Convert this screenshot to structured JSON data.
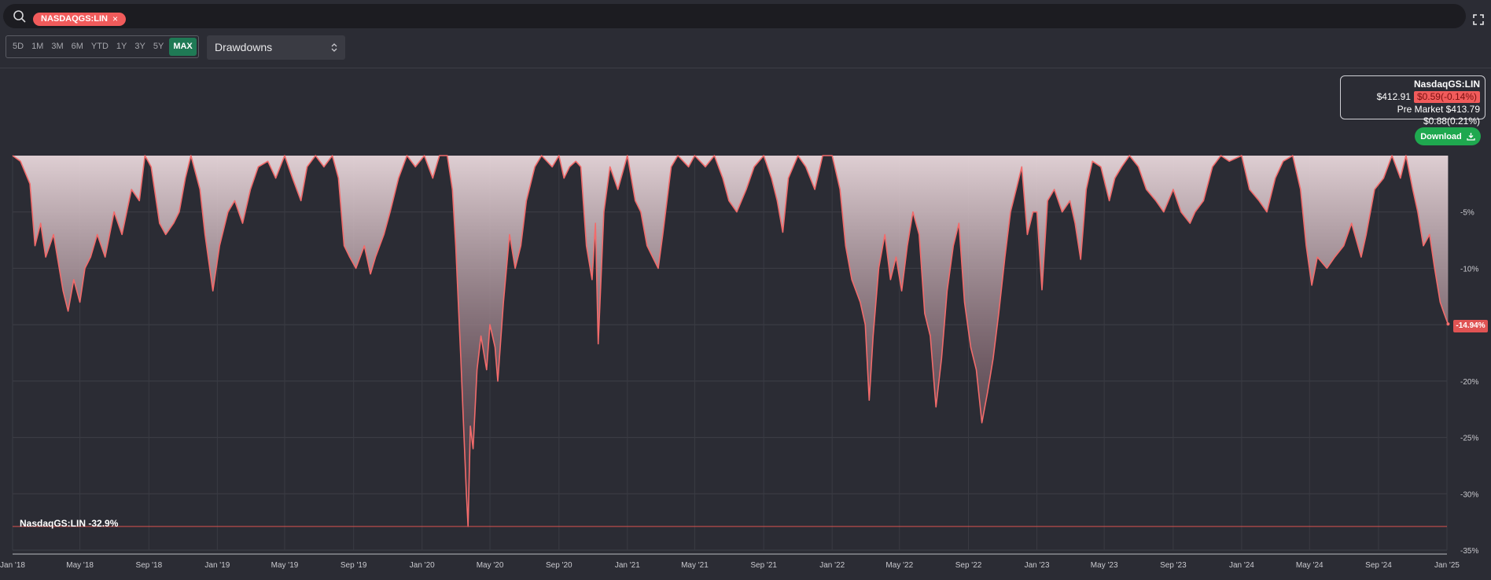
{
  "search": {
    "ticker": "NASDAQGS:LIN",
    "close_glyph": "×"
  },
  "toolbar": {
    "ranges": [
      "5D",
      "1M",
      "3M",
      "6M",
      "YTD",
      "1Y",
      "3Y",
      "5Y",
      "MAX"
    ],
    "active_range": "MAX",
    "metric_select": "Drawdowns"
  },
  "quote": {
    "symbol": "NasdaqGS:LIN",
    "price": "$412.91",
    "change": "$0.59(-0.14%)",
    "premarket": "Pre Market $413.79 $0.88(0.21%)"
  },
  "download_label": "Download",
  "colors": {
    "line": "#f26b6b",
    "up": "#1fa84f",
    "accent": "#f15b5b",
    "background": "#2b2c34"
  },
  "chart_data": {
    "type": "area",
    "series": [
      {
        "name": "NasdaqGS:LIN"
      }
    ],
    "x_ticks": [
      "Jan '18",
      "May '18",
      "Sep '18",
      "Jan '19",
      "May '19",
      "Sep '19",
      "Jan '20",
      "May '20",
      "Sep '20",
      "Jan '21",
      "May '21",
      "Sep '21",
      "Jan '22",
      "May '22",
      "Sep '22",
      "Jan '23",
      "May '23",
      "Sep '23",
      "Jan '24",
      "May '24",
      "Sep '24",
      "Jan '25"
    ],
    "y_ticks": [
      "-5%",
      "-10%",
      "-15%",
      "-20%",
      "-25%",
      "-30%",
      "-35%"
    ],
    "ylim": [
      -35,
      0
    ],
    "xlim": [
      "2018-01-01",
      "2025-01-01"
    ],
    "last_value_label": "-14.94%",
    "min_label": "NasdaqGS:LIN -32.9%",
    "min_value": -32.9,
    "points": [
      [
        "2018-01-01",
        0
      ],
      [
        "2018-01-15",
        -0.5
      ],
      [
        "2018-02-01",
        -2.5
      ],
      [
        "2018-02-10",
        -8
      ],
      [
        "2018-02-20",
        -6
      ],
      [
        "2018-03-01",
        -9
      ],
      [
        "2018-03-15",
        -7
      ],
      [
        "2018-04-01",
        -12
      ],
      [
        "2018-04-10",
        -13.8
      ],
      [
        "2018-04-20",
        -11
      ],
      [
        "2018-05-01",
        -13
      ],
      [
        "2018-05-10",
        -10
      ],
      [
        "2018-05-20",
        -9
      ],
      [
        "2018-06-01",
        -7
      ],
      [
        "2018-06-15",
        -9
      ],
      [
        "2018-07-01",
        -5
      ],
      [
        "2018-07-15",
        -7
      ],
      [
        "2018-08-01",
        -3
      ],
      [
        "2018-08-15",
        -4
      ],
      [
        "2018-08-25",
        0
      ],
      [
        "2018-09-05",
        -1
      ],
      [
        "2018-09-20",
        -6
      ],
      [
        "2018-10-01",
        -7
      ],
      [
        "2018-10-15",
        -6
      ],
      [
        "2018-10-25",
        -5
      ],
      [
        "2018-11-05",
        -2
      ],
      [
        "2018-11-15",
        0
      ],
      [
        "2018-12-01",
        -3
      ],
      [
        "2018-12-10",
        -7
      ],
      [
        "2018-12-24",
        -12
      ],
      [
        "2019-01-05",
        -8
      ],
      [
        "2019-01-20",
        -5
      ],
      [
        "2019-02-01",
        -4
      ],
      [
        "2019-02-15",
        -6
      ],
      [
        "2019-03-01",
        -3
      ],
      [
        "2019-03-15",
        -1
      ],
      [
        "2019-04-01",
        -0.5
      ],
      [
        "2019-04-15",
        -2
      ],
      [
        "2019-05-01",
        0
      ],
      [
        "2019-05-15",
        -2
      ],
      [
        "2019-05-30",
        -4
      ],
      [
        "2019-06-10",
        -1
      ],
      [
        "2019-06-25",
        0
      ],
      [
        "2019-07-10",
        -1
      ],
      [
        "2019-07-25",
        0
      ],
      [
        "2019-08-05",
        -2
      ],
      [
        "2019-08-15",
        -8
      ],
      [
        "2019-08-25",
        -9
      ],
      [
        "2019-09-05",
        -10
      ],
      [
        "2019-09-20",
        -8
      ],
      [
        "2019-10-01",
        -10.5
      ],
      [
        "2019-10-10",
        -9
      ],
      [
        "2019-10-25",
        -7
      ],
      [
        "2019-11-05",
        -5
      ],
      [
        "2019-11-20",
        -2
      ],
      [
        "2019-12-05",
        0
      ],
      [
        "2019-12-20",
        -1
      ],
      [
        "2020-01-05",
        0
      ],
      [
        "2020-01-20",
        -2
      ],
      [
        "2020-02-01",
        0
      ],
      [
        "2020-02-15",
        0
      ],
      [
        "2020-02-24",
        -3
      ],
      [
        "2020-03-01",
        -8
      ],
      [
        "2020-03-10",
        -18
      ],
      [
        "2020-03-15",
        -24
      ],
      [
        "2020-03-20",
        -30
      ],
      [
        "2020-03-23",
        -32.9
      ],
      [
        "2020-03-27",
        -24
      ],
      [
        "2020-04-01",
        -26
      ],
      [
        "2020-04-08",
        -19
      ],
      [
        "2020-04-15",
        -16
      ],
      [
        "2020-04-25",
        -19
      ],
      [
        "2020-05-01",
        -15
      ],
      [
        "2020-05-10",
        -17
      ],
      [
        "2020-05-15",
        -20
      ],
      [
        "2020-05-25",
        -13
      ],
      [
        "2020-06-05",
        -7
      ],
      [
        "2020-06-15",
        -10
      ],
      [
        "2020-06-25",
        -8
      ],
      [
        "2020-07-05",
        -4
      ],
      [
        "2020-07-20",
        -1
      ],
      [
        "2020-08-01",
        0
      ],
      [
        "2020-08-20",
        -1
      ],
      [
        "2020-09-01",
        0
      ],
      [
        "2020-09-10",
        -2
      ],
      [
        "2020-09-20",
        -1
      ],
      [
        "2020-10-01",
        -0.5
      ],
      [
        "2020-10-10",
        -1
      ],
      [
        "2020-10-20",
        -8
      ],
      [
        "2020-10-30",
        -11
      ],
      [
        "2020-11-05",
        -6
      ],
      [
        "2020-11-10",
        -16.7
      ],
      [
        "2020-11-20",
        -5
      ],
      [
        "2020-12-01",
        -1
      ],
      [
        "2020-12-15",
        -3
      ],
      [
        "2021-01-01",
        0
      ],
      [
        "2021-01-15",
        -4
      ],
      [
        "2021-01-25",
        -5
      ],
      [
        "2021-02-05",
        -8
      ],
      [
        "2021-02-15",
        -9
      ],
      [
        "2021-02-25",
        -10
      ],
      [
        "2021-03-05",
        -7
      ],
      [
        "2021-03-20",
        -1
      ],
      [
        "2021-04-01",
        0
      ],
      [
        "2021-04-20",
        -1
      ],
      [
        "2021-05-01",
        0
      ],
      [
        "2021-05-20",
        -1
      ],
      [
        "2021-06-05",
        0
      ],
      [
        "2021-06-20",
        -2
      ],
      [
        "2021-07-01",
        -4
      ],
      [
        "2021-07-15",
        -5
      ],
      [
        "2021-08-01",
        -3
      ],
      [
        "2021-08-15",
        -1
      ],
      [
        "2021-09-01",
        0
      ],
      [
        "2021-09-15",
        -2
      ],
      [
        "2021-09-25",
        -4
      ],
      [
        "2021-10-05",
        -6.8
      ],
      [
        "2021-10-15",
        -2
      ],
      [
        "2021-11-01",
        0
      ],
      [
        "2021-11-15",
        -1
      ],
      [
        "2021-12-01",
        -3
      ],
      [
        "2021-12-15",
        0
      ],
      [
        "2022-01-01",
        0
      ],
      [
        "2022-01-15",
        -3
      ],
      [
        "2022-01-25",
        -8
      ],
      [
        "2022-02-05",
        -11
      ],
      [
        "2022-02-20",
        -13
      ],
      [
        "2022-03-01",
        -15
      ],
      [
        "2022-03-08",
        -21.7
      ],
      [
        "2022-03-15",
        -16
      ],
      [
        "2022-03-25",
        -10
      ],
      [
        "2022-04-05",
        -7
      ],
      [
        "2022-04-15",
        -11
      ],
      [
        "2022-04-25",
        -9
      ],
      [
        "2022-05-05",
        -12
      ],
      [
        "2022-05-15",
        -8
      ],
      [
        "2022-05-25",
        -5
      ],
      [
        "2022-06-05",
        -7
      ],
      [
        "2022-06-15",
        -14
      ],
      [
        "2022-06-25",
        -16
      ],
      [
        "2022-07-05",
        -22.3
      ],
      [
        "2022-07-15",
        -18
      ],
      [
        "2022-07-25",
        -12
      ],
      [
        "2022-08-05",
        -8
      ],
      [
        "2022-08-15",
        -6
      ],
      [
        "2022-08-25",
        -13
      ],
      [
        "2022-09-05",
        -17
      ],
      [
        "2022-09-15",
        -19
      ],
      [
        "2022-09-25",
        -23.7
      ],
      [
        "2022-10-05",
        -21
      ],
      [
        "2022-10-15",
        -18
      ],
      [
        "2022-10-25",
        -14
      ],
      [
        "2022-11-05",
        -9
      ],
      [
        "2022-11-15",
        -5
      ],
      [
        "2022-11-25",
        -3
      ],
      [
        "2022-12-05",
        -1
      ],
      [
        "2022-12-15",
        -7
      ],
      [
        "2022-12-25",
        -5
      ],
      [
        "2023-01-01",
        -5
      ],
      [
        "2023-01-10",
        -11.9
      ],
      [
        "2023-01-20",
        -4
      ],
      [
        "2023-02-01",
        -3
      ],
      [
        "2023-02-15",
        -5
      ],
      [
        "2023-03-01",
        -4
      ],
      [
        "2023-03-10",
        -6
      ],
      [
        "2023-03-20",
        -9.2
      ],
      [
        "2023-03-30",
        -3
      ],
      [
        "2023-04-10",
        -0.5
      ],
      [
        "2023-04-25",
        -1
      ],
      [
        "2023-05-10",
        -4
      ],
      [
        "2023-05-20",
        -2
      ],
      [
        "2023-06-01",
        -1
      ],
      [
        "2023-06-15",
        0
      ],
      [
        "2023-07-01",
        -1
      ],
      [
        "2023-07-15",
        -3
      ],
      [
        "2023-08-01",
        -4
      ],
      [
        "2023-08-15",
        -5
      ],
      [
        "2023-09-01",
        -3
      ],
      [
        "2023-09-15",
        -5
      ],
      [
        "2023-10-01",
        -6
      ],
      [
        "2023-10-10",
        -5
      ],
      [
        "2023-10-25",
        -4
      ],
      [
        "2023-11-10",
        -1
      ],
      [
        "2023-11-25",
        0
      ],
      [
        "2023-12-10",
        -0.5
      ],
      [
        "2024-01-01",
        0
      ],
      [
        "2024-01-15",
        -3
      ],
      [
        "2024-02-01",
        -4
      ],
      [
        "2024-02-15",
        -5
      ],
      [
        "2024-03-01",
        -2
      ],
      [
        "2024-03-15",
        -0.5
      ],
      [
        "2024-04-01",
        0
      ],
      [
        "2024-04-15",
        -3
      ],
      [
        "2024-04-25",
        -8
      ],
      [
        "2024-05-05",
        -11.5
      ],
      [
        "2024-05-15",
        -9
      ],
      [
        "2024-06-01",
        -10
      ],
      [
        "2024-06-15",
        -9
      ],
      [
        "2024-07-01",
        -8
      ],
      [
        "2024-07-15",
        -6
      ],
      [
        "2024-08-01",
        -9
      ],
      [
        "2024-08-10",
        -7
      ],
      [
        "2024-08-25",
        -3
      ],
      [
        "2024-09-10",
        -2
      ],
      [
        "2024-09-25",
        0
      ],
      [
        "2024-10-10",
        -2
      ],
      [
        "2024-10-20",
        0
      ],
      [
        "2024-11-01",
        -3
      ],
      [
        "2024-11-10",
        -5
      ],
      [
        "2024-11-20",
        -8
      ],
      [
        "2024-12-01",
        -7
      ],
      [
        "2024-12-10",
        -10
      ],
      [
        "2024-12-20",
        -13
      ],
      [
        "2024-12-27",
        -14
      ],
      [
        "2025-01-03",
        -14.94
      ]
    ]
  }
}
